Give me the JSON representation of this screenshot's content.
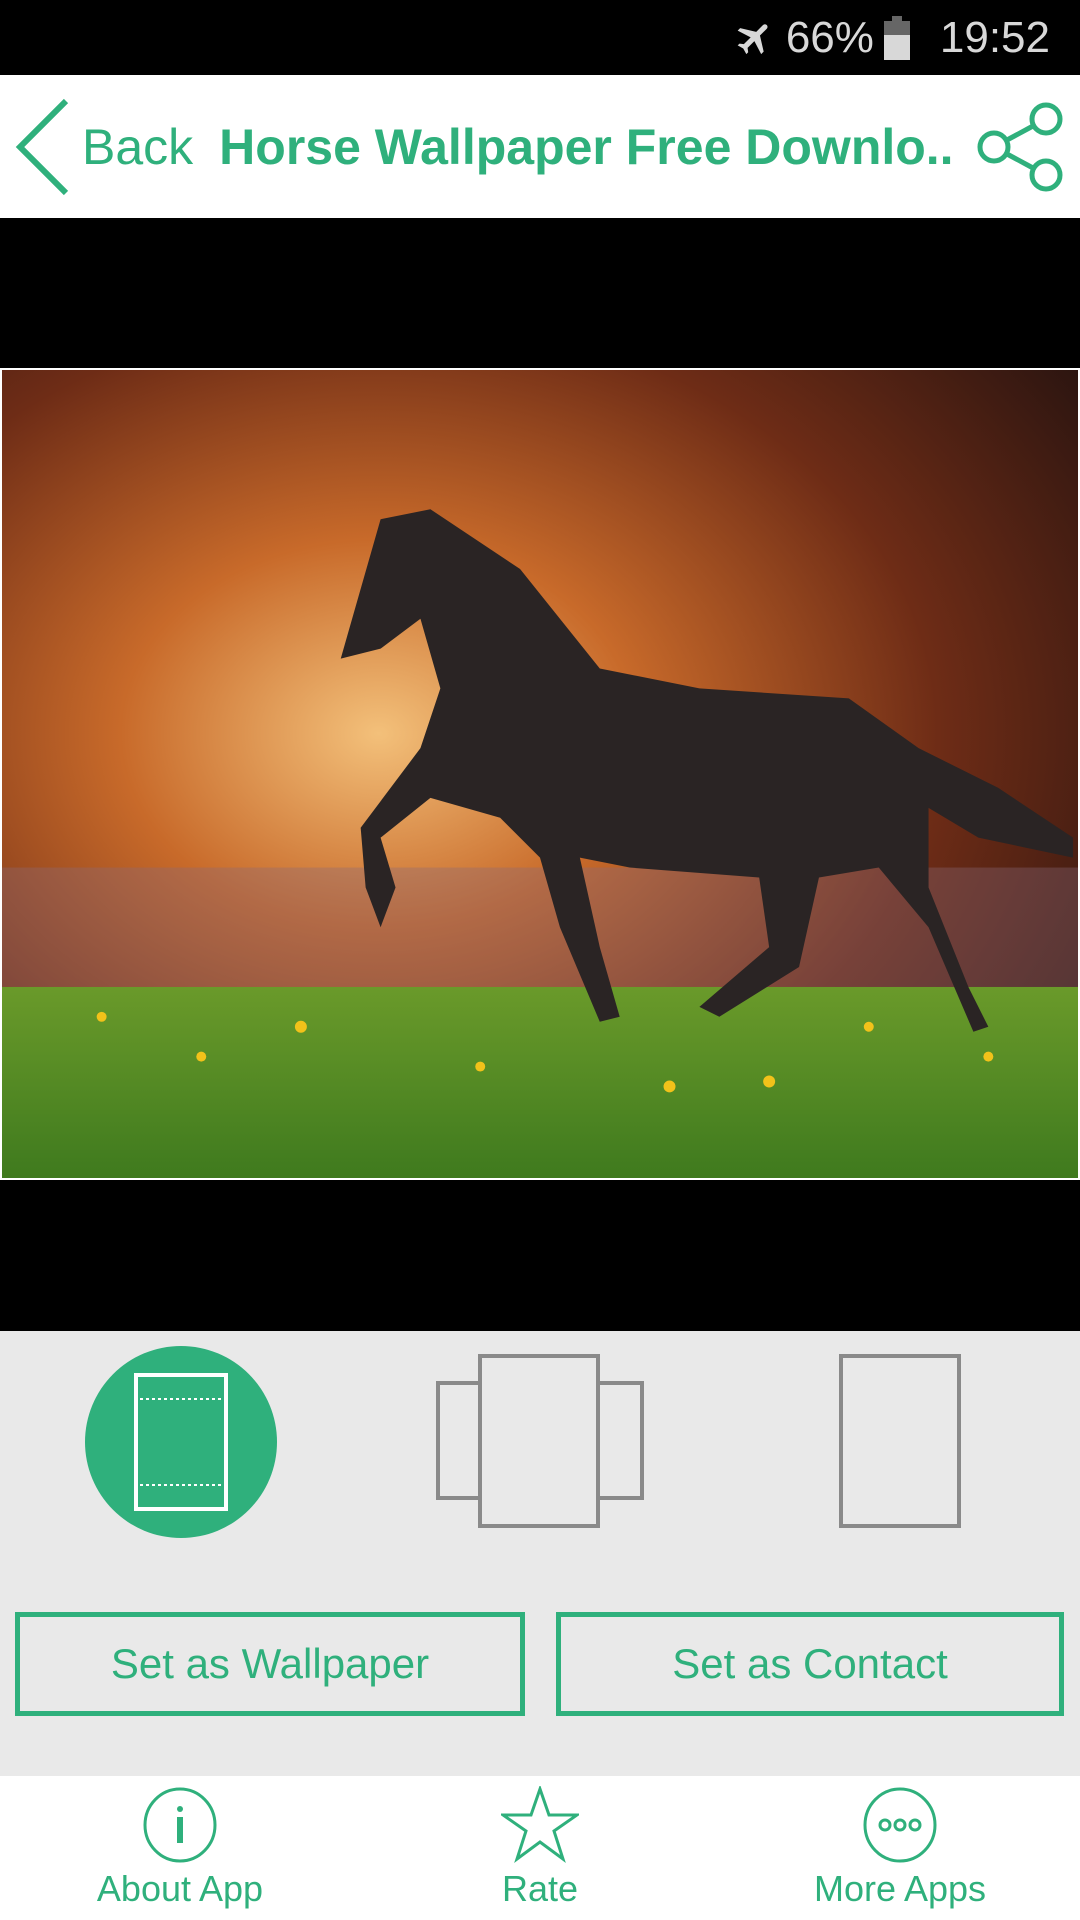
{
  "status_bar": {
    "battery": "66%",
    "time": "19:52",
    "icons": [
      "airplane-mode-icon",
      "battery-icon"
    ]
  },
  "header": {
    "back_label": "Back",
    "title": "Horse Wallpaper Free Downlo..",
    "share_icon": "share-icon"
  },
  "colors": {
    "accent": "#2fb07c",
    "panel": "#e9e9e9",
    "icon_gray": "#8a8a8a"
  },
  "modes": [
    {
      "name": "fit-screen",
      "selected": true
    },
    {
      "name": "scrollable",
      "selected": false
    },
    {
      "name": "fixed",
      "selected": false
    }
  ],
  "actions": {
    "set_wallpaper": "Set as Wallpaper",
    "set_contact": "Set as Contact"
  },
  "bottom_nav": [
    {
      "label": "About App",
      "icon": "info-icon"
    },
    {
      "label": "Rate",
      "icon": "star-icon"
    },
    {
      "label": "More Apps",
      "icon": "more-icon"
    }
  ]
}
